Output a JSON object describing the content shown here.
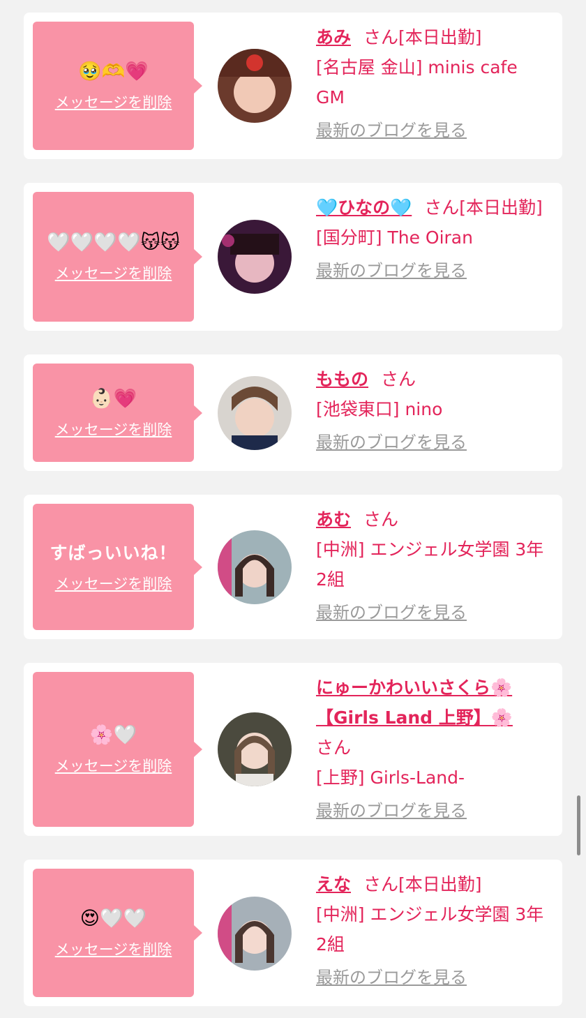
{
  "delete_label": "メッセージを削除",
  "blog_label": "最新のブログを見る",
  "honorific": "さん",
  "cards": [
    {
      "message": "🥹🫶💗",
      "name": "あみ",
      "status": "[本日出勤]",
      "shop": "[名古屋 金山] minis cafe GM"
    },
    {
      "message": "🤍🤍🤍🤍😽😽",
      "name": "🩵ひなの🩵",
      "status": "[本日出勤]",
      "shop": "[国分町] The Oiran"
    },
    {
      "message": "👶🏻💗",
      "name": "ももの",
      "status": "",
      "shop": "[池袋東口] nino"
    },
    {
      "message": "すばっいいね！",
      "name": "あむ",
      "status": "",
      "shop": "[中洲] エンジェル女学園 3年2組"
    },
    {
      "message": "🌸🤍",
      "name": "にゅーかわいいさくら🌸【Girls Land 上野】🌸",
      "status": "",
      "shop": "[上野] Girls-Land-"
    },
    {
      "message": "😍🤍🤍",
      "name": "えな",
      "status": "[本日出勤]",
      "shop": "[中洲] エンジェル女学園 3年2組"
    }
  ],
  "colors": {
    "page_bg": "#f2f2f2",
    "bubble": "#f993a6",
    "accent": "#e3245a",
    "link_gray": "#9a9a9a"
  }
}
